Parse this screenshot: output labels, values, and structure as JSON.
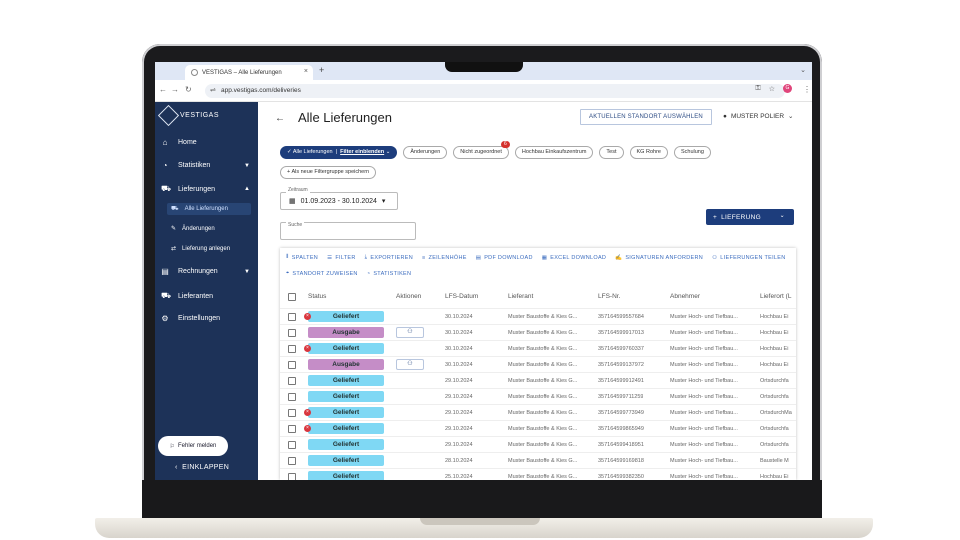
{
  "browser": {
    "tab_title": "VESTIGAS – Alle Lieferungen",
    "tab_close": "×",
    "new_tab": "+",
    "url": "app.vestigas.com/deliveries",
    "profile_initial": "G"
  },
  "sidebar": {
    "brand": "VESTIGAS",
    "items": [
      {
        "label": "Home",
        "icon": "home-icon"
      },
      {
        "label": "Statistiken",
        "icon": "chart-icon"
      },
      {
        "label": "Lieferungen",
        "icon": "truck-icon"
      },
      {
        "label": "Rechnungen",
        "icon": "invoice-icon"
      },
      {
        "label": "Lieferanten",
        "icon": "supplier-icon"
      },
      {
        "label": "Einstellungen",
        "icon": "gear-icon"
      }
    ],
    "subitems": [
      {
        "label": "Alle Lieferungen"
      },
      {
        "label": "Änderungen"
      },
      {
        "label": "Lieferung anlegen"
      }
    ],
    "report_button": "Fehler melden",
    "collapse_label": "EINKLAPPEN"
  },
  "header": {
    "title": "Alle Lieferungen",
    "location_button": "AKTUELLEN STANDORT AUSWÄHLEN",
    "user_name": "MUSTER POLIER"
  },
  "filters": {
    "active_chip": "Alle Lieferungen",
    "active_chip_action": "Filter einblenden",
    "chips": [
      "Änderungen",
      "Nicht zugeordnet",
      "Hochbau Einkaufszentrum",
      "Test",
      "KG Rohre",
      "Schulung"
    ],
    "badge_count": "6",
    "new_group": "Als neue Filtergruppe speichern"
  },
  "date_filter": {
    "label": "Zeitraum",
    "value": "01.09.2023 - 30.10.2024"
  },
  "search": {
    "label": "Suche"
  },
  "create_button": "LIEFERUNG",
  "toolbar": {
    "items": [
      "SPALTEN",
      "FILTER",
      "EXPORTIEREN",
      "ZEILENHÖHE",
      "PDF DOWNLOAD",
      "EXCEL DOWNLOAD",
      "SIGNATUREN ANFORDERN",
      "LIEFERUNGEN TEILEN",
      "STANDORT ZUWEISEN",
      "STATISTIKEN"
    ]
  },
  "table": {
    "columns": [
      "Status",
      "Aktionen",
      "LFS-Datum",
      "Lieferant",
      "LFS-Nr.",
      "Abnehmer",
      "Lieferort (L"
    ],
    "rows": [
      {
        "status": "Geliefert",
        "error": true,
        "action": false,
        "date": "30.10.2024",
        "supplier": "Muster Baustoffe & Kies G...",
        "nr": "357164599557684",
        "recipient": "Muster Hoch- und Tiefbau...",
        "place": "Hochbau Ei"
      },
      {
        "status": "Ausgabe",
        "error": false,
        "action": true,
        "date": "30.10.2024",
        "supplier": "Muster Baustoffe & Kies G...",
        "nr": "357164599917013",
        "recipient": "Muster Hoch- und Tiefbau...",
        "place": "Hochbau Ei"
      },
      {
        "status": "Geliefert",
        "error": true,
        "action": false,
        "date": "30.10.2024",
        "supplier": "Muster Baustoffe & Kies G...",
        "nr": "357164599760337",
        "recipient": "Muster Hoch- und Tiefbau...",
        "place": "Hochbau Ei"
      },
      {
        "status": "Ausgabe",
        "error": false,
        "action": true,
        "date": "30.10.2024",
        "supplier": "Muster Baustoffe & Kies G...",
        "nr": "357164599137972",
        "recipient": "Muster Hoch- und Tiefbau...",
        "place": "Hochbau Ei"
      },
      {
        "status": "Geliefert",
        "error": false,
        "action": false,
        "date": "29.10.2024",
        "supplier": "Muster Baustoffe & Kies G...",
        "nr": "357164599912491",
        "recipient": "Muster Hoch- und Tiefbau...",
        "place": "Ortsdurchfa"
      },
      {
        "status": "Geliefert",
        "error": false,
        "action": false,
        "date": "29.10.2024",
        "supplier": "Muster Baustoffe & Kies G...",
        "nr": "357164599711259",
        "recipient": "Muster Hoch- und Tiefbau...",
        "place": "Ortsdurchfa"
      },
      {
        "status": "Geliefert",
        "error": true,
        "action": false,
        "date": "29.10.2024",
        "supplier": "Muster Baustoffe & Kies G...",
        "nr": "357164599773949",
        "recipient": "Muster Hoch- und Tiefbau...",
        "place": "OrtsdurchMa"
      },
      {
        "status": "Geliefert",
        "error": true,
        "action": false,
        "date": "29.10.2024",
        "supplier": "Muster Baustoffe & Kies G...",
        "nr": "357164599865949",
        "recipient": "Muster Hoch- und Tiefbau...",
        "place": "Ortsdurchfa"
      },
      {
        "status": "Geliefert",
        "error": false,
        "action": false,
        "date": "29.10.2024",
        "supplier": "Muster Baustoffe & Kies G...",
        "nr": "357164599418951",
        "recipient": "Muster Hoch- und Tiefbau...",
        "place": "Ortsdurchfa"
      },
      {
        "status": "Geliefert",
        "error": false,
        "action": false,
        "date": "28.10.2024",
        "supplier": "Muster Baustoffe & Kies G...",
        "nr": "357164599169818",
        "recipient": "Muster Hoch- und Tiefbau...",
        "place": "Baustelle M"
      },
      {
        "status": "Geliefert",
        "error": false,
        "action": false,
        "date": "25.10.2024",
        "supplier": "Muster Baustoffe & Kies G...",
        "nr": "357164599382350",
        "recipient": "Muster Hoch- und Tiefbau...",
        "place": "Hochbau Ei"
      }
    ]
  },
  "colors": {
    "sidebar": "#1d3258",
    "primary": "#1d3d7c",
    "geliefert": "#7fd8f4",
    "ausgabe": "#c58dc7",
    "error": "#d9363e",
    "toolbar_text": "#3c6dbf"
  }
}
